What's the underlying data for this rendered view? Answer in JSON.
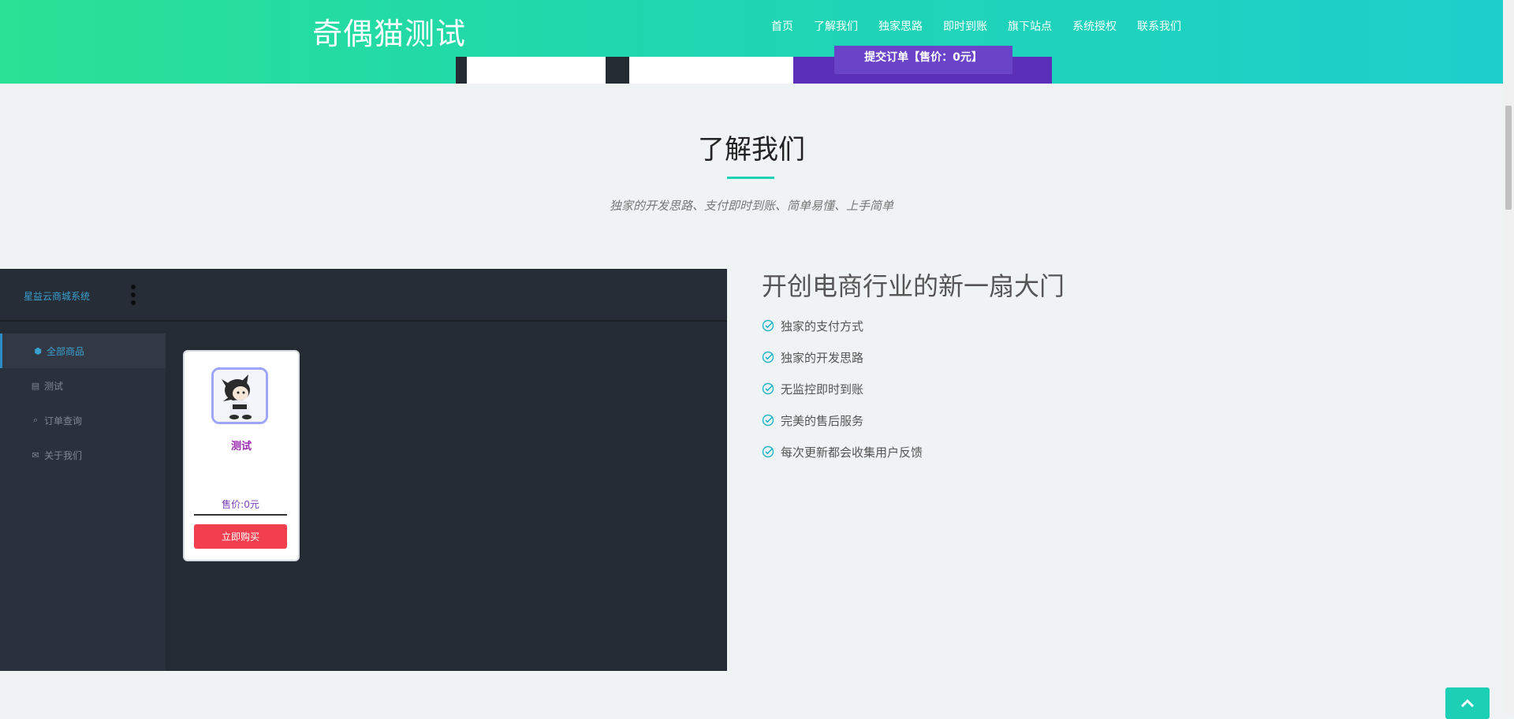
{
  "navbar": {
    "brand": "奇偶猫测试",
    "links": [
      "首页",
      "了解我们",
      "独家思路",
      "即时到账",
      "旗下站点",
      "系统授权",
      "联系我们"
    ],
    "preview_button": "提交订单【售价：0元】"
  },
  "about": {
    "title": "了解我们",
    "subtitle": "独家的开发思路、支付即时到账、简单易懂、上手简单"
  },
  "demo_panel": {
    "logo": "星益云商城系统",
    "sidebar": [
      {
        "icon": "cube-icon",
        "label": "全部商品"
      },
      {
        "icon": "id-card-icon",
        "label": "测试"
      },
      {
        "icon": "search-icon",
        "label": "订单查询"
      },
      {
        "icon": "envelope-icon",
        "label": "关于我们"
      }
    ],
    "product": {
      "name": "测试",
      "price": "售价:0元",
      "buy_label": "立即购买"
    }
  },
  "features": {
    "title": "开创电商行业的新一扇大门",
    "items": [
      "独家的支付方式",
      "独家的开发思路",
      "无监控即时到账",
      "完美的售后服务",
      "每次更新都会收集用户反馈"
    ]
  },
  "colors": {
    "accent": "#1fd1b3",
    "buy": "#f23f4f",
    "panel_bg": "#252b35"
  }
}
